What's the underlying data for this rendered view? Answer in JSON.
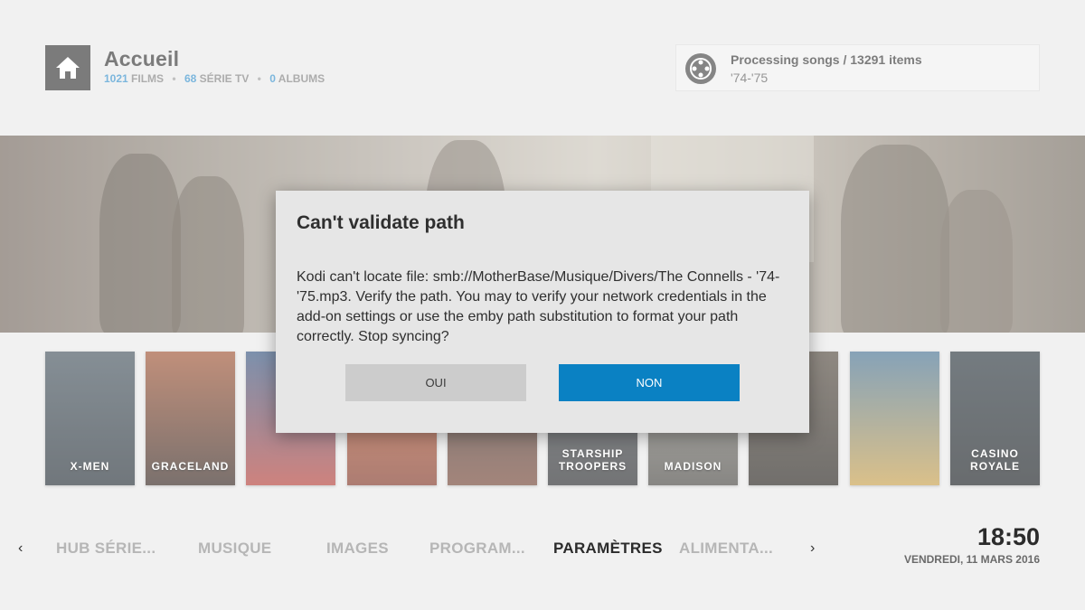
{
  "header": {
    "title": "Accueil",
    "films_count": "1021",
    "films_label": "FILMS",
    "series_count": "68",
    "series_label": "SÉRIE TV",
    "albums_count": "0",
    "albums_label": "ALBUMS",
    "separator": "•"
  },
  "progress": {
    "title": "Processing songs / 13291 items",
    "subtitle": "'74-'75",
    "icon": "emby-logo-icon"
  },
  "posters": [
    {
      "title": "X-MEN",
      "color_top": "#3b4a55",
      "color_bottom": "#1a242c"
    },
    {
      "title": "GRACELAND",
      "color_top": "#9a4b2a",
      "color_bottom": "#2a1a14"
    },
    {
      "title": "",
      "color_top": "#2c4d7a",
      "color_bottom": "#b0362f"
    },
    {
      "title": "",
      "color_top": "#c55b2c",
      "color_bottom": "#7a2d1c"
    },
    {
      "title": "",
      "color_top": "#222222",
      "color_bottom": "#6b3a2a"
    },
    {
      "title": "STARSHIP TROOPERS",
      "color_top": "#42454a",
      "color_bottom": "#1d1f22"
    },
    {
      "title": "MADISON",
      "color_top": "#8c8a82",
      "color_bottom": "#3f3d38"
    },
    {
      "title": "",
      "color_top": "#4a4034",
      "color_bottom": "#1b1712"
    },
    {
      "title": "",
      "color_top": "#3d6a8c",
      "color_bottom": "#c49a42"
    },
    {
      "title": "CASINO ROYALE",
      "color_top": "#1f2b33",
      "color_bottom": "#0d1216"
    }
  ],
  "nav": {
    "items": [
      "HUB SÉRIE...",
      "MUSIQUE",
      "IMAGES",
      "PROGRAM...",
      "PARAMÈTRES",
      "ALIMENTA..."
    ],
    "left_arrow": "‹",
    "right_arrow": "›"
  },
  "clock": {
    "time": "18:50",
    "date": "VENDREDI, 11 MARS 2016"
  },
  "dialog": {
    "title": "Can't validate path",
    "message": "Kodi can't locate file: smb://MotherBase/Musique/Divers/The Connells - '74-'75.mp3. Verify the path. You may to verify your network credentials in the add-on settings or use the emby path substitution to format your path correctly. Stop syncing?",
    "yes_label": "OUI",
    "no_label": "NON"
  },
  "colors": {
    "accent": "#0a81c3",
    "stat_number": "#2a8ac8"
  }
}
